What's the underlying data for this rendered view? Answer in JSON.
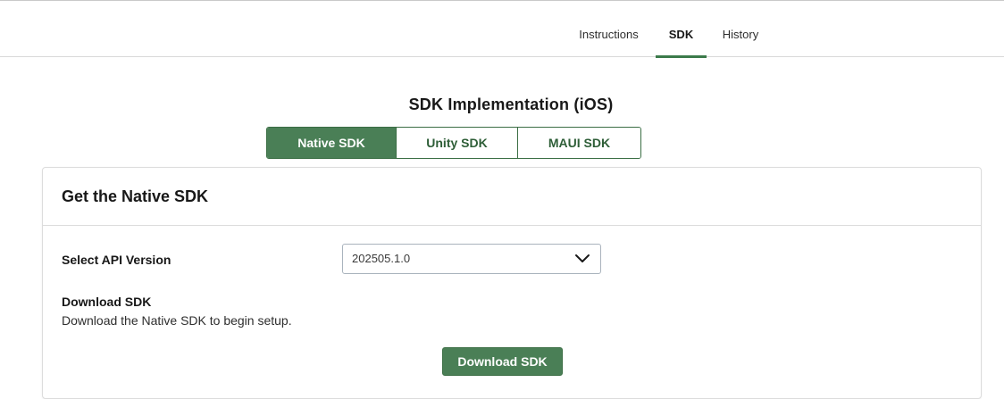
{
  "tabs": [
    {
      "label": "Instructions",
      "active": false
    },
    {
      "label": "SDK",
      "active": true
    },
    {
      "label": "History",
      "active": false
    }
  ],
  "page": {
    "heading": "SDK Implementation (iOS)"
  },
  "sdk_options": [
    {
      "label": "Native SDK",
      "selected": true
    },
    {
      "label": "Unity SDK",
      "selected": false
    },
    {
      "label": "MAUI SDK",
      "selected": false
    }
  ],
  "card": {
    "title": "Get the Native SDK",
    "api_version_label": "Select API Version",
    "api_version_value": "202505.1.0",
    "download_title": "Download SDK",
    "download_description": "Download the Native SDK to begin setup.",
    "download_button": "Download SDK"
  },
  "icons": {
    "dropdown": "chevron-down-icon"
  },
  "colors": {
    "accent": "#4a7f56",
    "accent_border": "#3b6e44",
    "tab_indicator": "#3b7a4a"
  }
}
